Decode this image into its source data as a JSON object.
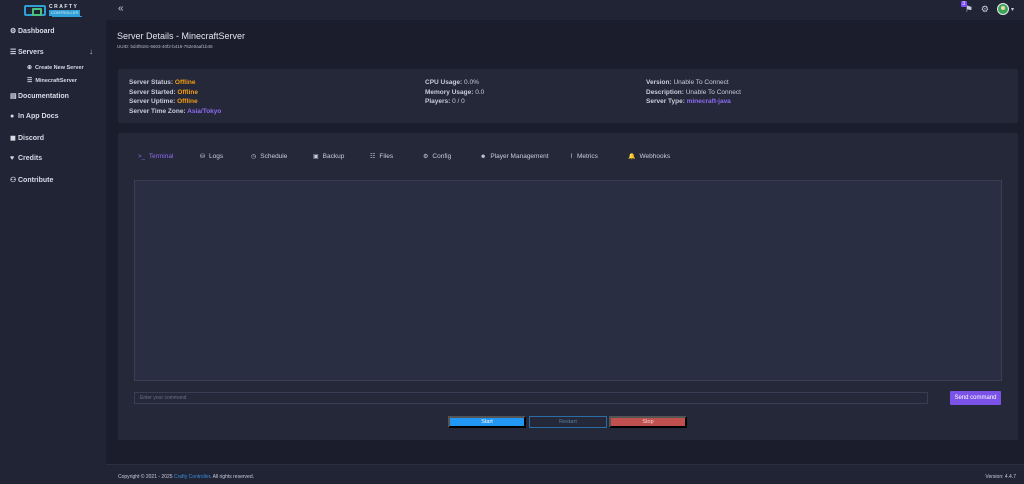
{
  "logo": {
    "line1": "CRAFTY",
    "line2": "CONTROLLER"
  },
  "sidebar": {
    "items": [
      {
        "icon": "dashboard-icon",
        "glyph": "⚙",
        "label": "Dashboard"
      },
      {
        "icon": "servers-icon",
        "glyph": "☰",
        "label": "Servers"
      },
      {
        "icon": "documentation-icon",
        "glyph": "▤",
        "label": "Documentation"
      },
      {
        "icon": "info-icon",
        "glyph": "●",
        "label": "In App Docs"
      },
      {
        "icon": "discord-icon",
        "glyph": "◼",
        "label": "Discord"
      },
      {
        "icon": "heart-icon",
        "glyph": "♥",
        "label": "Credits"
      },
      {
        "icon": "contribute-icon",
        "glyph": "⚇",
        "label": "Contribute"
      }
    ],
    "sub_items": [
      {
        "icon": "plus-circle-icon",
        "glyph": "⊕",
        "label": "Create New Server"
      },
      {
        "icon": "server-icon",
        "glyph": "☰",
        "label": "MinecraftServer"
      }
    ]
  },
  "topbar": {
    "badge": "3"
  },
  "page": {
    "title": "Server Details - MinecraftServer",
    "uuid": "UUID: bd4f918c-6603-40f2-b415-752e0aaf1b45"
  },
  "info": {
    "status_label": "Server Status:",
    "status_value": "Offline",
    "started_label": "Server Started:",
    "started_value": "Offline",
    "uptime_label": "Server Uptime:",
    "uptime_value": "Offline",
    "timezone_label": "Server Time Zone:",
    "timezone_value": "Asia/Tokyo",
    "cpu_label": "CPU Usage:",
    "cpu_value": "0.0%",
    "memory_label": "Memory Usage:",
    "memory_value": "0.0",
    "players_label": "Players:",
    "players_value": "0 / 0",
    "version_label": "Version:",
    "version_value": "Unable To Connect",
    "description_label": "Description:",
    "description_value": "Unable To Connect",
    "type_label": "Server Type:",
    "type_value": "minecraft-java"
  },
  "tabs": [
    {
      "icon": "terminal-icon",
      "glyph": ">_",
      "label": "Terminal"
    },
    {
      "icon": "logs-icon",
      "glyph": "⛁",
      "label": "Logs"
    },
    {
      "icon": "clock-icon",
      "glyph": "◷",
      "label": "Schedule"
    },
    {
      "icon": "backup-icon",
      "glyph": "▣",
      "label": "Backup"
    },
    {
      "icon": "files-icon",
      "glyph": "☷",
      "label": "Files"
    },
    {
      "icon": "config-icon",
      "glyph": "⚙",
      "label": "Config"
    },
    {
      "icon": "users-icon",
      "glyph": "☻",
      "label": "Player Management"
    },
    {
      "icon": "metrics-icon",
      "glyph": "⌇",
      "label": "Metrics"
    },
    {
      "icon": "bell-icon",
      "glyph": "🔔",
      "label": "Webhooks"
    }
  ],
  "terminal": {
    "input_placeholder": "Enter your command",
    "send_label": "Send command"
  },
  "controls": {
    "start": "Start",
    "restart": "Restart",
    "stop": "Stop"
  },
  "footer": {
    "copyright_prefix": "Copyright © 2021 - 2025 ",
    "copyright_link": "Crafty Controller",
    "copyright_suffix": ". All rights reserved.",
    "version": "Version: 4.4.7"
  },
  "colors": {
    "accent": "#7b52e8",
    "offline": "#f39c12",
    "start": "#2196f3",
    "stop": "#c0504d"
  }
}
